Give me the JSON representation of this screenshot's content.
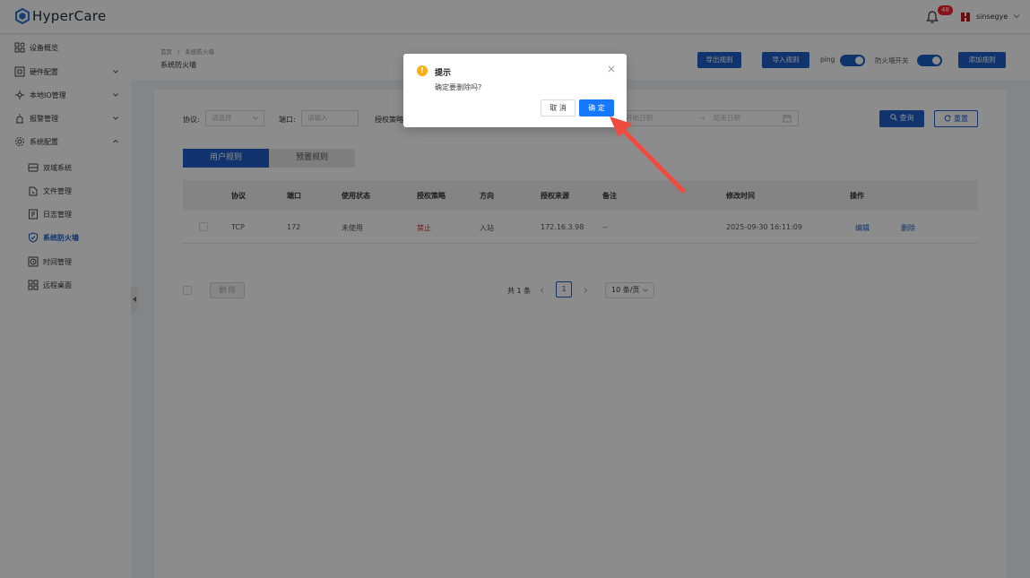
{
  "app": {
    "name": "HyperCare",
    "notification_count": "48",
    "username": "sinsegye"
  },
  "sidebar": {
    "items": [
      {
        "label": "设备概览",
        "icon": "grid-icon",
        "expandable": false
      },
      {
        "label": "硬件配置",
        "icon": "hardware-icon",
        "expandable": true
      },
      {
        "label": "本地IO管理",
        "icon": "io-icon",
        "expandable": true
      },
      {
        "label": "报警管理",
        "icon": "alarm-icon",
        "expandable": true
      },
      {
        "label": "系统配置",
        "icon": "gear-icon",
        "expandable": true,
        "expanded": true
      }
    ],
    "subitems": [
      {
        "label": "双域系统",
        "icon": "dual-domain-icon"
      },
      {
        "label": "文件管理",
        "icon": "file-icon"
      },
      {
        "label": "日志管理",
        "icon": "log-icon"
      },
      {
        "label": "系统防火墙",
        "icon": "shield-icon",
        "active": true
      },
      {
        "label": "时间管理",
        "icon": "clock-icon"
      },
      {
        "label": "远程桌面",
        "icon": "desktop-icon"
      }
    ]
  },
  "header": {
    "breadcrumb_home": "首页",
    "breadcrumb_sep": "/",
    "breadcrumb_current": "系统防火墙",
    "title": "系统防火墙",
    "export_label": "导出规则",
    "import_label": "导入规则",
    "ping_label": "ping",
    "firewall_label": "防火墙开关",
    "add_label": "添加规则",
    "ping_on": true,
    "firewall_on": true
  },
  "filters": {
    "protocol_label": "协议:",
    "protocol_placeholder": "请选择",
    "port_label": "端口:",
    "port_placeholder": "请输入",
    "policy_label": "授权策略",
    "start_placeholder": "开始日期",
    "range_sep": "→",
    "end_placeholder": "结束日期",
    "search_label": "查询",
    "reset_label": "重置"
  },
  "tabs": [
    {
      "label": "用户规则",
      "active": true
    },
    {
      "label": "预置规则",
      "active": false
    }
  ],
  "table": {
    "columns": [
      "协议",
      "端口",
      "使用状态",
      "授权策略",
      "方向",
      "授权来源",
      "备注",
      "修改时间",
      "操作"
    ],
    "rows": [
      {
        "protocol": "TCP",
        "port": "172",
        "status": "未使用",
        "policy": "禁止",
        "direction": "入站",
        "source": "172.16.3.98",
        "remark": "--",
        "modified": "2025-09-30 16:11:09",
        "edit_label": "编辑",
        "delete_label": "删除"
      }
    ]
  },
  "footer": {
    "batch_delete_label": "删 除",
    "total_text": "共 1 条",
    "current_page": "1",
    "page_size": "10 条/页"
  },
  "modal": {
    "title": "提示",
    "message": "确定要删除吗?",
    "cancel_label": "取 消",
    "confirm_label": "确 定",
    "icon": "warning-icon"
  },
  "colors": {
    "primary": "#1f5fc9",
    "danger": "#e02424",
    "warning": "#faad14",
    "annotation": "#f04b3e"
  }
}
